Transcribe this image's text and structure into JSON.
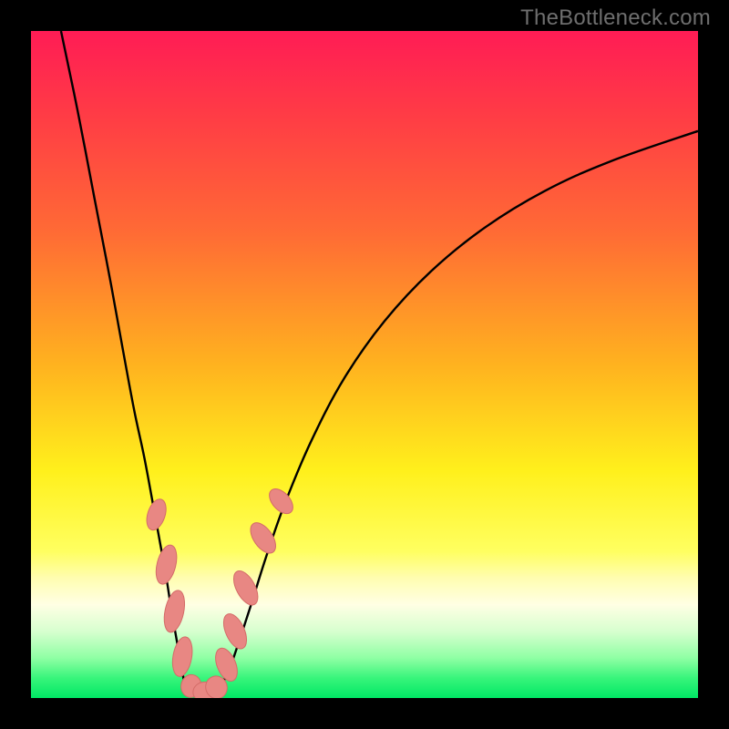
{
  "watermark": "TheBottleneck.com",
  "colors": {
    "black": "#000000",
    "curve": "#000000",
    "marker_fill": "#e88783",
    "marker_stroke": "#d46c68"
  },
  "chart_data": {
    "type": "line",
    "title": "",
    "xlabel": "",
    "ylabel": "",
    "xlim": [
      0,
      100
    ],
    "ylim": [
      0,
      100
    ],
    "gradient_stops": [
      {
        "offset": 0.0,
        "color": "#ff1c55"
      },
      {
        "offset": 0.12,
        "color": "#ff3a46"
      },
      {
        "offset": 0.3,
        "color": "#ff6a35"
      },
      {
        "offset": 0.5,
        "color": "#ffb21f"
      },
      {
        "offset": 0.66,
        "color": "#fff01c"
      },
      {
        "offset": 0.78,
        "color": "#ffff60"
      },
      {
        "offset": 0.82,
        "color": "#fffdb0"
      },
      {
        "offset": 0.86,
        "color": "#ffffe4"
      },
      {
        "offset": 0.9,
        "color": "#d7ffcf"
      },
      {
        "offset": 0.94,
        "color": "#8fffa4"
      },
      {
        "offset": 0.97,
        "color": "#38f57b"
      },
      {
        "offset": 1.0,
        "color": "#00e765"
      }
    ],
    "series": [
      {
        "name": "left-branch",
        "x": [
          4.5,
          7.0,
          9.5,
          12.0,
          14.0,
          15.5,
          17.0,
          18.3,
          19.4,
          20.3,
          21.0,
          21.7,
          22.4,
          23.0
        ],
        "y": [
          100,
          88,
          75,
          62,
          51,
          43,
          36,
          29,
          23,
          18,
          13.5,
          9.5,
          5.5,
          2.2
        ]
      },
      {
        "name": "valley-floor",
        "x": [
          23.0,
          24.2,
          25.5,
          27.0,
          28.5
        ],
        "y": [
          2.2,
          0.7,
          0.3,
          0.6,
          1.8
        ]
      },
      {
        "name": "right-branch",
        "x": [
          28.5,
          29.8,
          31.2,
          33.0,
          35.2,
          38.0,
          42.0,
          47.0,
          53.0,
          60.0,
          68.0,
          77.0,
          87.0,
          100.0
        ],
        "y": [
          1.8,
          4.5,
          8.5,
          14.0,
          21.0,
          29.0,
          38.5,
          48.0,
          56.5,
          64.0,
          70.5,
          76.0,
          80.5,
          85.0
        ]
      }
    ],
    "markers": [
      {
        "shape": "rounded",
        "cx": 18.8,
        "cy": 27.5,
        "rx": 1.3,
        "ry": 2.4,
        "rot": 18
      },
      {
        "shape": "rounded",
        "cx": 20.3,
        "cy": 20.0,
        "rx": 1.4,
        "ry": 3.0,
        "rot": 14
      },
      {
        "shape": "rounded",
        "cx": 21.5,
        "cy": 13.0,
        "rx": 1.4,
        "ry": 3.2,
        "rot": 12
      },
      {
        "shape": "rounded",
        "cx": 22.7,
        "cy": 6.2,
        "rx": 1.4,
        "ry": 3.0,
        "rot": 10
      },
      {
        "shape": "rounded",
        "cx": 24.0,
        "cy": 1.8,
        "rx": 1.5,
        "ry": 1.7,
        "rot": 10
      },
      {
        "shape": "rounded",
        "cx": 26.0,
        "cy": 0.9,
        "rx": 1.7,
        "ry": 1.5,
        "rot": -5
      },
      {
        "shape": "rounded",
        "cx": 27.8,
        "cy": 1.6,
        "rx": 1.6,
        "ry": 1.7,
        "rot": -20
      },
      {
        "shape": "rounded",
        "cx": 29.3,
        "cy": 5.0,
        "rx": 1.4,
        "ry": 2.6,
        "rot": -22
      },
      {
        "shape": "rounded",
        "cx": 30.6,
        "cy": 10.0,
        "rx": 1.4,
        "ry": 2.8,
        "rot": -24
      },
      {
        "shape": "rounded",
        "cx": 32.2,
        "cy": 16.5,
        "rx": 1.4,
        "ry": 2.8,
        "rot": -28
      },
      {
        "shape": "rounded",
        "cx": 34.8,
        "cy": 24.0,
        "rx": 1.4,
        "ry": 2.6,
        "rot": -35
      },
      {
        "shape": "rounded",
        "cx": 37.5,
        "cy": 29.5,
        "rx": 1.3,
        "ry": 2.2,
        "rot": -42
      }
    ]
  }
}
